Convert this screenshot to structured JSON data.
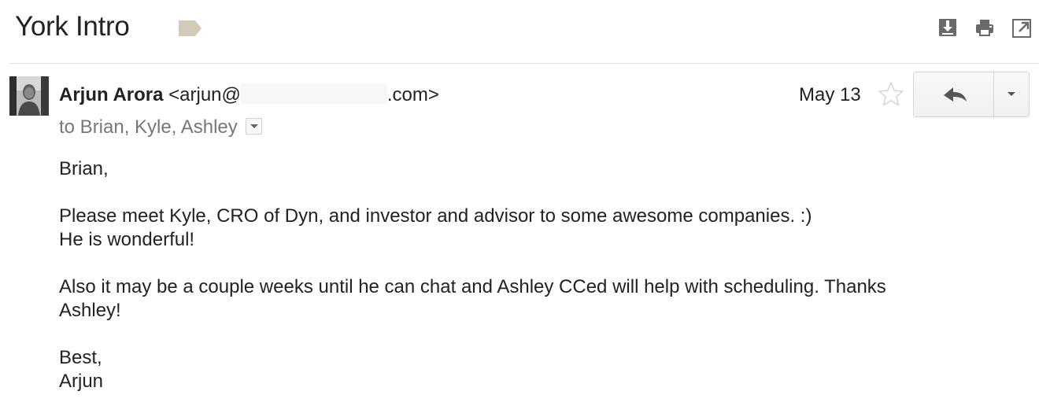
{
  "thread": {
    "subject": "York Intro",
    "label_color": "#d2cbb8"
  },
  "toolbar": {
    "icons": [
      "download-icon",
      "print-icon",
      "open-new-window-icon"
    ]
  },
  "message": {
    "sender_name": "Arjun Arora",
    "sender_email_prefix": "<arjun@",
    "sender_email_suffix": ".com>",
    "recipients": "to Brian, Kyle, Ashley",
    "date": "May 13",
    "body": {
      "greeting": "Brian,",
      "para1_line1": "Please meet Kyle, CRO of Dyn, and investor and advisor to some awesome companies. :)",
      "para1_line2": "He is wonderful!",
      "para2_line1": "Also it may be a couple weeks until he can chat and Ashley CCed will help with scheduling. Thanks",
      "para2_line2": "Ashley!",
      "signoff": "Best,",
      "signature": "Arjun"
    }
  },
  "colors": {
    "text": "#222222",
    "muted": "#777777",
    "divider": "#e3e3e3",
    "icon": "#666666"
  }
}
